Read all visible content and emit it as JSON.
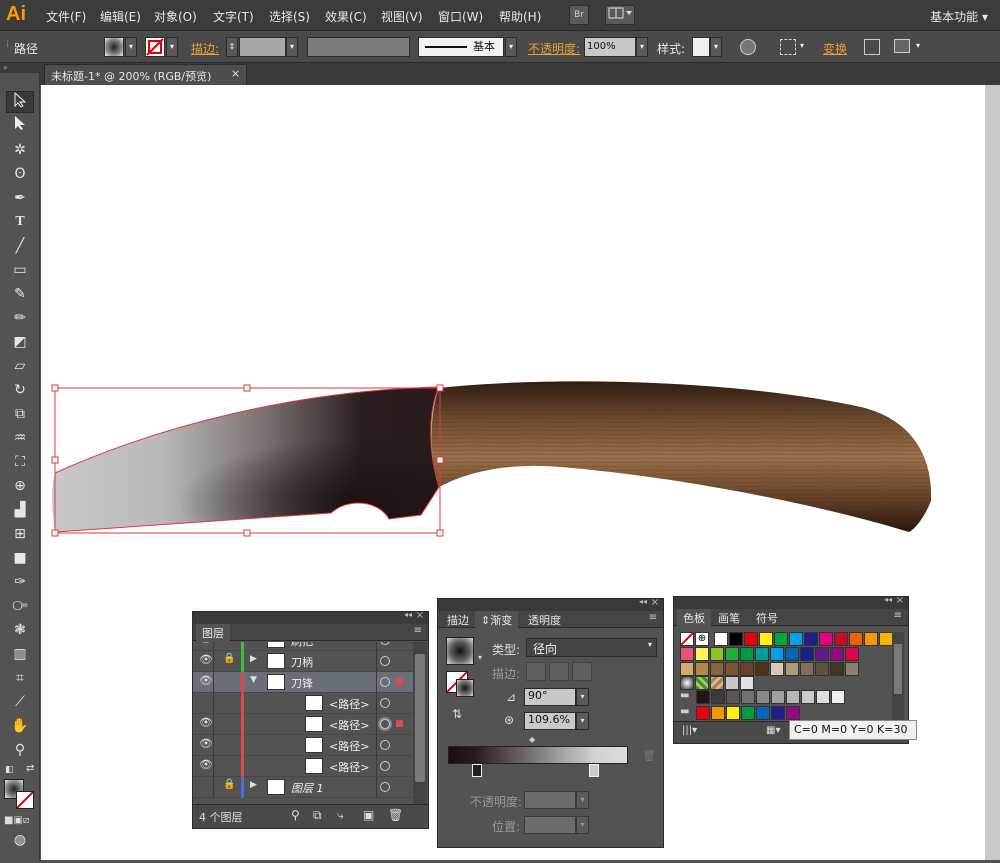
{
  "app": {
    "logo": "Ai",
    "workspace": "基本功能"
  },
  "menu": [
    "文件(F)",
    "编辑(E)",
    "对象(O)",
    "文字(T)",
    "选择(S)",
    "效果(C)",
    "视图(V)",
    "窗口(W)",
    "帮助(H)"
  ],
  "menu_buttons": {
    "bridge": "Br"
  },
  "control": {
    "selection_type": "路径",
    "stroke_label": "描边:",
    "stroke_style": "基本",
    "opacity_label": "不透明度:",
    "opacity_value": "100%",
    "style_label": "样式:",
    "transform_label": "变换"
  },
  "document_tab": {
    "title": "未标题-1* @ 200% (RGB/预览)",
    "close": "×"
  },
  "layers_panel": {
    "tab": "图层",
    "layers": [
      {
        "name": "刷把",
        "color": "#3fbf3f",
        "visible": true,
        "locked": false,
        "indent": 0,
        "expanded": false
      },
      {
        "name": "刀柄",
        "color": "#3fbf3f",
        "visible": true,
        "locked": true,
        "indent": 0,
        "expanded": false
      },
      {
        "name": "刀锋",
        "color": "#e04848",
        "visible": true,
        "locked": false,
        "indent": 0,
        "expanded": true,
        "selected": true
      },
      {
        "name": "<路径>",
        "color": "#e04848",
        "visible": false,
        "locked": false,
        "indent": 1
      },
      {
        "name": "<路径>",
        "color": "#e04848",
        "visible": true,
        "locked": false,
        "indent": 1,
        "targeted": true
      },
      {
        "name": "<路径>",
        "color": "#e04848",
        "visible": true,
        "locked": false,
        "indent": 1
      },
      {
        "name": "<路径>",
        "color": "#e04848",
        "visible": true,
        "locked": false,
        "indent": 1
      },
      {
        "name": "图层 1",
        "color": "#4a6fd8",
        "visible": false,
        "locked": true,
        "indent": 0,
        "expanded": false
      }
    ],
    "footer_count": "4 个图层"
  },
  "gradient_panel": {
    "tabs": [
      "描边",
      "渐变",
      "透明度"
    ],
    "active_tab": "渐变",
    "type_label": "类型:",
    "type_value": "径向",
    "stroke_label": "描边:",
    "angle_value": "90°",
    "aspect_value": "109.6%",
    "opacity_label": "不透明度:",
    "location_label": "位置:"
  },
  "swatches_panel": {
    "tabs": [
      "色板",
      "画笔",
      "符号"
    ],
    "active_tab": "色板",
    "tooltip": "C=0 M=0 Y=0 K=30",
    "row1": [
      "#ffffff",
      "#000000",
      "#e60012",
      "#fff100",
      "#00a73c",
      "#00a0e9",
      "#1d2088",
      "#e4007f",
      "#c30d23",
      "#eb6100",
      "#f39800",
      "#f8b500"
    ],
    "row2": [
      "#e95377",
      "#fff45c",
      "#8fc31f",
      "#22ac38",
      "#009944",
      "#009e96",
      "#00a0e9",
      "#0068b7",
      "#1d2088",
      "#601986",
      "#920783",
      "#e5004f"
    ],
    "row3": [
      "#d7a86e",
      "#b4884a",
      "#8b6240",
      "#7b5434",
      "#6a4226",
      "#4f301b",
      "#d9c9b0",
      "#ac9a7c",
      "#7f6f56",
      "#5e513d",
      "#3f3626",
      "#8a7e6f"
    ],
    "row5": [
      "#231815",
      "#3e3a39",
      "#595757",
      "#727171",
      "#898989",
      "#9fa0a0",
      "#b5b5b6",
      "#c9caca",
      "#dcdddd",
      "#efefef"
    ],
    "row6": [
      "#e60012",
      "#f39800",
      "#fff100",
      "#009944",
      "#0068b7",
      "#1d2088",
      "#920783"
    ]
  }
}
